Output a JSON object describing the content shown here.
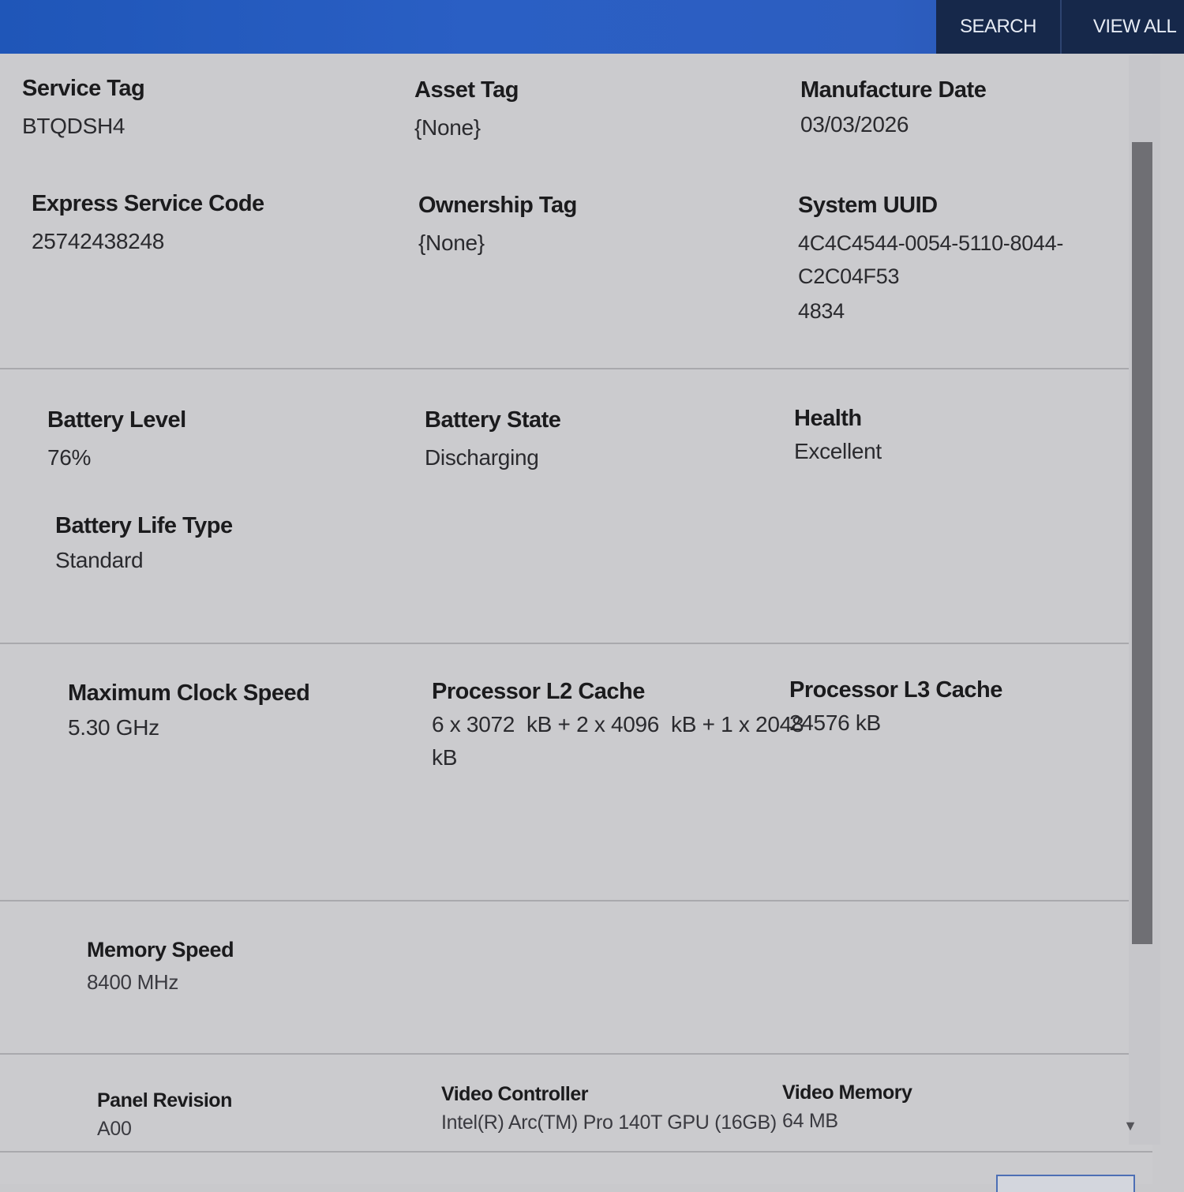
{
  "nav": {
    "search_label": "SEARCH",
    "view_all_label": "VIEW ALL"
  },
  "colors": {
    "header_blue": "#2a5fc4",
    "nav_dark": "#16284a",
    "panel_bg": "#cbcbce"
  },
  "system": {
    "service_tag": {
      "label": "Service Tag",
      "value": "BTQDSH4"
    },
    "asset_tag": {
      "label": "Asset Tag",
      "value": "{None}"
    },
    "manufacture_date": {
      "label": "Manufacture Date",
      "value": "03/03/2026"
    },
    "express_service_code": {
      "label": "Express Service Code",
      "value": "25742438248"
    },
    "ownership_tag": {
      "label": "Ownership Tag",
      "value": "{None}"
    },
    "system_uuid": {
      "label": "System UUID",
      "value_line1": "4C4C4544-0054-5110-8044-C2C04F53",
      "value_line2": "4834"
    }
  },
  "battery": {
    "level": {
      "label": "Battery Level",
      "value": "76%"
    },
    "state": {
      "label": "Battery State",
      "value": "Discharging"
    },
    "health": {
      "label": "Health",
      "value": "Excellent"
    },
    "life_type": {
      "label": "Battery Life Type",
      "value": "Standard"
    }
  },
  "processor": {
    "max_clock": {
      "label": "Maximum Clock Speed",
      "value": "5.30 GHz"
    },
    "l2_cache": {
      "label": "Processor L2 Cache",
      "value_line1": "6 x 3072  kB + 2 x 4096  kB + 1 x 2048",
      "value_line2": "kB"
    },
    "l3_cache": {
      "label": "Processor L3 Cache",
      "value": "24576 kB"
    }
  },
  "memory": {
    "speed": {
      "label": "Memory Speed",
      "value": "8400 MHz"
    }
  },
  "video": {
    "panel_revision": {
      "label": "Panel Revision",
      "value": "A00"
    },
    "controller": {
      "label": "Video Controller",
      "value": "Intel(R) Arc(TM) Pro 140T GPU (16GB)"
    },
    "memory": {
      "label": "Video Memory",
      "value": "64 MB"
    }
  },
  "icons": {
    "scroll_down": "scroll-down-arrow"
  }
}
